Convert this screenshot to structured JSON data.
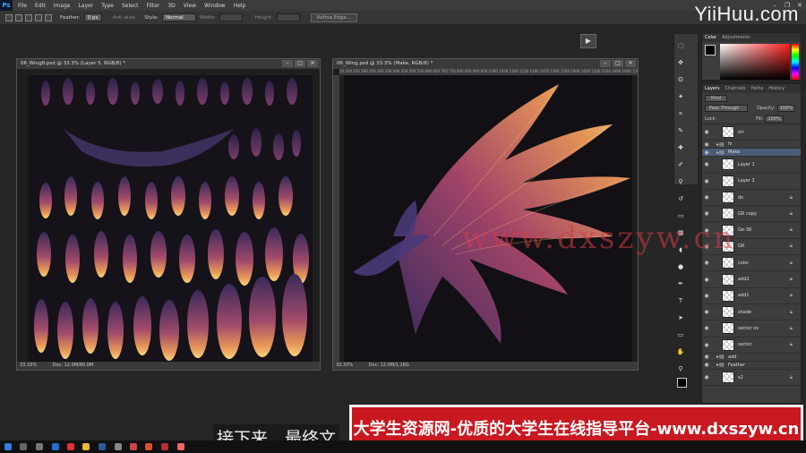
{
  "menubar": {
    "logo": "Ps",
    "items": [
      "File",
      "Edit",
      "Image",
      "Layer",
      "Type",
      "Select",
      "Filter",
      "3D",
      "View",
      "Window",
      "Help"
    ]
  },
  "optbar": {
    "feather_label": "Feather:",
    "feather_value": "0 px",
    "antialias": "Anti-alias",
    "style_label": "Style:",
    "style_value": "Normal",
    "width_label": "Width:",
    "height_label": "Height:",
    "refine_btn": "Refine Edge..."
  },
  "watermark": "YiiHuu.com",
  "doc1": {
    "title": "06_Wing8.psd @ 33.3% (Layer 5, RGB/8) *",
    "zoom": "33.33%",
    "docsize": "Doc: 12.0M/80.0M"
  },
  "doc2": {
    "title": "06_Wing.psd @ 33.3% (Make, RGB/8) *",
    "zoom": "33.33%",
    "docsize": "Doc: 12.0M/1.16G",
    "ruler": "50 100 150 200 250 300 350 400 450 500 550 600 650 700 750 800 850 900 950 1000 1050 1100 1150 1200 1250 1300 1350 1400 1450 1500 1550 1600 1650 1700 1750 1800"
  },
  "color_panel": {
    "tabs": [
      "Color",
      "Adjustments"
    ]
  },
  "layers_panel": {
    "tabs": [
      "Layers",
      "Channels",
      "Paths",
      "History"
    ],
    "kind": "Kind",
    "blend": "Pass Through",
    "opacity_label": "Opacity:",
    "opacity": "100%",
    "lock_label": "Lock:",
    "fill_label": "Fill:",
    "fill": "100%",
    "layers": [
      {
        "name": "str",
        "type": "layer"
      },
      {
        "name": "fs",
        "type": "group"
      },
      {
        "name": "Make",
        "type": "group-selected"
      },
      {
        "name": "Layer 1",
        "type": "layer"
      },
      {
        "name": "Layer 2",
        "type": "layer"
      },
      {
        "name": "dx",
        "type": "layer"
      },
      {
        "name": "GR copy",
        "type": "layer"
      },
      {
        "name": "Ge-38",
        "type": "layer"
      },
      {
        "name": "GR",
        "type": "layer"
      },
      {
        "name": "color",
        "type": "layer"
      },
      {
        "name": "add2",
        "type": "layer"
      },
      {
        "name": "add1",
        "type": "layer"
      },
      {
        "name": "shade",
        "type": "layer"
      },
      {
        "name": "sector ov",
        "type": "layer"
      },
      {
        "name": "sector",
        "type": "layer"
      },
      {
        "name": "add",
        "type": "group"
      },
      {
        "name": "Feather",
        "type": "group"
      },
      {
        "name": "s2",
        "type": "layer"
      }
    ]
  },
  "subtitle": "接下来，最终文",
  "banner": "大学生资源网-优质的大学生在线指导平台-www.dxszyw.cn",
  "overlay_url": "www.dxszyw.cn",
  "colors": {
    "accent_red": "#c81820",
    "selected_layer": "#4a5b77",
    "ps_blue": "#39a8ff"
  }
}
